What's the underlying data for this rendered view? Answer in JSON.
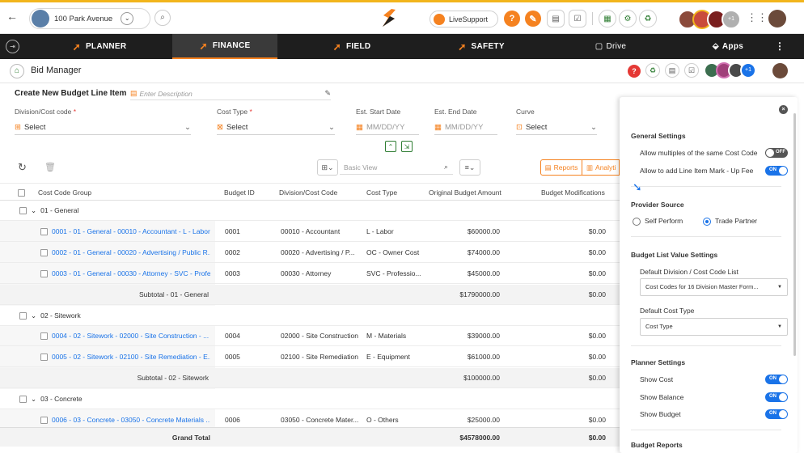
{
  "topbar": {
    "project_name": "100 Park Avenue",
    "live_support_label": "LiveSupport",
    "avatar_count": "+1"
  },
  "nav": {
    "tabs": [
      {
        "label": "PLANNER"
      },
      {
        "label": "FINANCE"
      },
      {
        "label": "FIELD"
      },
      {
        "label": "SAFETY"
      },
      {
        "label": "Drive"
      },
      {
        "label": "Apps"
      }
    ]
  },
  "bidbar": {
    "title": "Bid Manager",
    "avatar_count": "+1"
  },
  "form": {
    "title": "Create New Budget Line Item",
    "description_placeholder": "Enter Description",
    "division_label": "Division/Cost code",
    "division_value": "Select",
    "cost_type_label": "Cost Type",
    "cost_type_value": "Select",
    "start_date_label": "Est. Start Date",
    "start_date_placeholder": "MM/DD/YY",
    "end_date_label": "Est. End Date",
    "end_date_placeholder": "MM/DD/YY",
    "curve_label": "Curve",
    "curve_value": "Select",
    "required_mark": "*"
  },
  "toolbar": {
    "view_placeholder": "Basic View",
    "reports_label": "Reports",
    "analytics_label": "Analyti"
  },
  "table": {
    "headers": {
      "group": "Cost Code Group",
      "budget_id": "Budget ID",
      "division": "Division/Cost Code",
      "cost_type": "Cost Type",
      "original": "Original Budget Amount",
      "modifications": "Budget Modifications"
    },
    "groups": [
      {
        "name": "01 - General",
        "items": [
          {
            "code": "0001 - 01 - General - 00010 - Accountant - L - Labor",
            "id": "0001",
            "division": "00010 - Accountant",
            "type": "L - Labor",
            "original": "$60000.00",
            "mod": "$0.00"
          },
          {
            "code": "0002 - 01 - General - 00020 - Advertising / Public R...",
            "id": "0002",
            "division": "00020 - Advertising / P...",
            "type": "OC - Owner Cost",
            "original": "$74000.00",
            "mod": "$0.00"
          },
          {
            "code": "0003 - 01 - General - 00030 - Attorney - SVC - Profe...",
            "id": "0003",
            "division": "00030 - Attorney",
            "type": "SVC - Professio...",
            "original": "$45000.00",
            "mod": "$0.00"
          }
        ],
        "subtotal_label": "Subtotal - 01 - General",
        "subtotal_original": "$1790000.00",
        "subtotal_mod": "$0.00"
      },
      {
        "name": "02 - Sitework",
        "items": [
          {
            "code": "0004 - 02 - Sitework - 02000 - Site Construction - ...",
            "id": "0004",
            "division": "02000 - Site Construction",
            "type": "M - Materials",
            "original": "$39000.00",
            "mod": "$0.00"
          },
          {
            "code": "0005 - 02 - Sitework - 02100 - Site Remediation - E...",
            "id": "0005",
            "division": "02100 - Site Remediation",
            "type": "E - Equipment",
            "original": "$61000.00",
            "mod": "$0.00"
          }
        ],
        "subtotal_label": "Subtotal - 02 - Sitework",
        "subtotal_original": "$100000.00",
        "subtotal_mod": "$0.00"
      },
      {
        "name": "03 - Concrete",
        "items": [
          {
            "code": "0006 - 03 - Concrete - 03050 - Concrete Materials ...",
            "id": "0006",
            "division": "03050 - Concrete Mater...",
            "type": "O - Others",
            "original": "$25000.00",
            "mod": "$0.00"
          }
        ]
      }
    ],
    "grand_total_label": "Grand Total",
    "grand_total_original": "$4578000.00",
    "grand_total_mod": "$0.00"
  },
  "panel": {
    "general_title": "General Settings",
    "allow_multiples_label": "Allow multiples of the same Cost Code",
    "allow_multiples_state": "OFF",
    "allow_markup_label": "Allow to add Line Item Mark - Up Fee",
    "allow_markup_state": "ON",
    "provider_title": "Provider Source",
    "self_perform_label": "Self Perform",
    "trade_partner_label": "Trade Partner",
    "budget_list_title": "Budget List Value Settings",
    "default_division_label": "Default Division / Cost Code List",
    "default_division_value": "Cost Codes for 16 Division Master Form...",
    "default_cost_type_label": "Default  Cost Type",
    "default_cost_type_value": "Cost Type",
    "planner_title": "Planner Settings",
    "show_cost_label": "Show Cost",
    "show_cost_state": "ON",
    "show_balance_label": "Show Balance",
    "show_balance_state": "ON",
    "show_budget_label": "Show Budget",
    "show_budget_state": "ON",
    "budget_reports_title": "Budget Reports"
  },
  "colors": {
    "accent_orange": "#f58220",
    "link_blue": "#1a73e8",
    "nav_dark": "#1e1e1e",
    "top_stripe": "#f2b51c"
  }
}
